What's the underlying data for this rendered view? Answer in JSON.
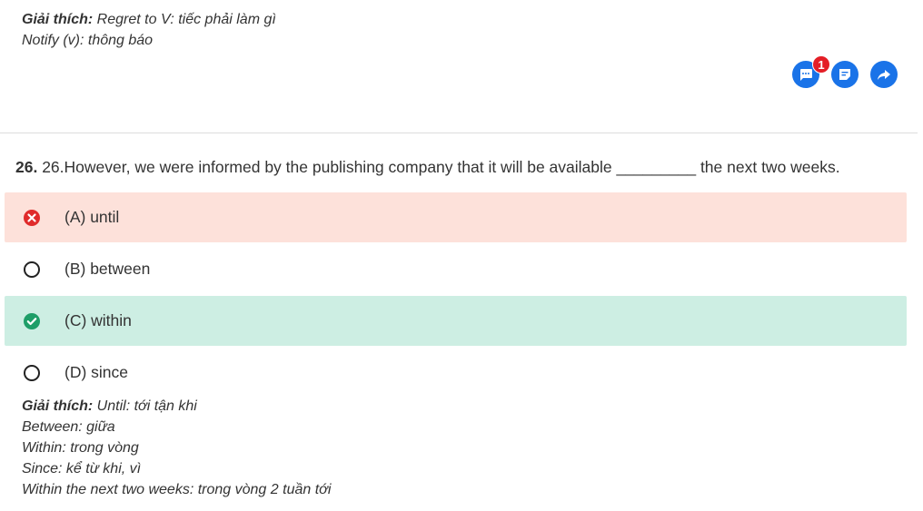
{
  "previous_explanation": {
    "heading": "Giải thích:",
    "line1": " Regret to V: tiếc phải làm gì",
    "line2": "Notify (v): thông báo"
  },
  "actions": {
    "comment_badge": "1",
    "icons": [
      "comment-icon",
      "note-icon",
      "share-icon"
    ],
    "accent_color": "#1a73e8"
  },
  "question": {
    "number": "26.",
    "text": "26.However, we were informed by the publishing company that it will be available _________ the next two weeks."
  },
  "options": [
    {
      "label": "(A) until",
      "state": "wrong",
      "color": "#fde1da"
    },
    {
      "label": "(B) between",
      "state": "neutral"
    },
    {
      "label": "(C) within",
      "state": "correct",
      "color": "#cdeee3"
    },
    {
      "label": "(D) since",
      "state": "neutral"
    }
  ],
  "explanation": {
    "heading": "Giải thích:",
    "line1": " Until: tới tận khi",
    "line2": "Between: giữa",
    "line3": "Within: trong vòng",
    "line4": "Since: kể từ khi, vì",
    "line5": "Within the next two weeks: trong vòng 2 tuần tới"
  }
}
